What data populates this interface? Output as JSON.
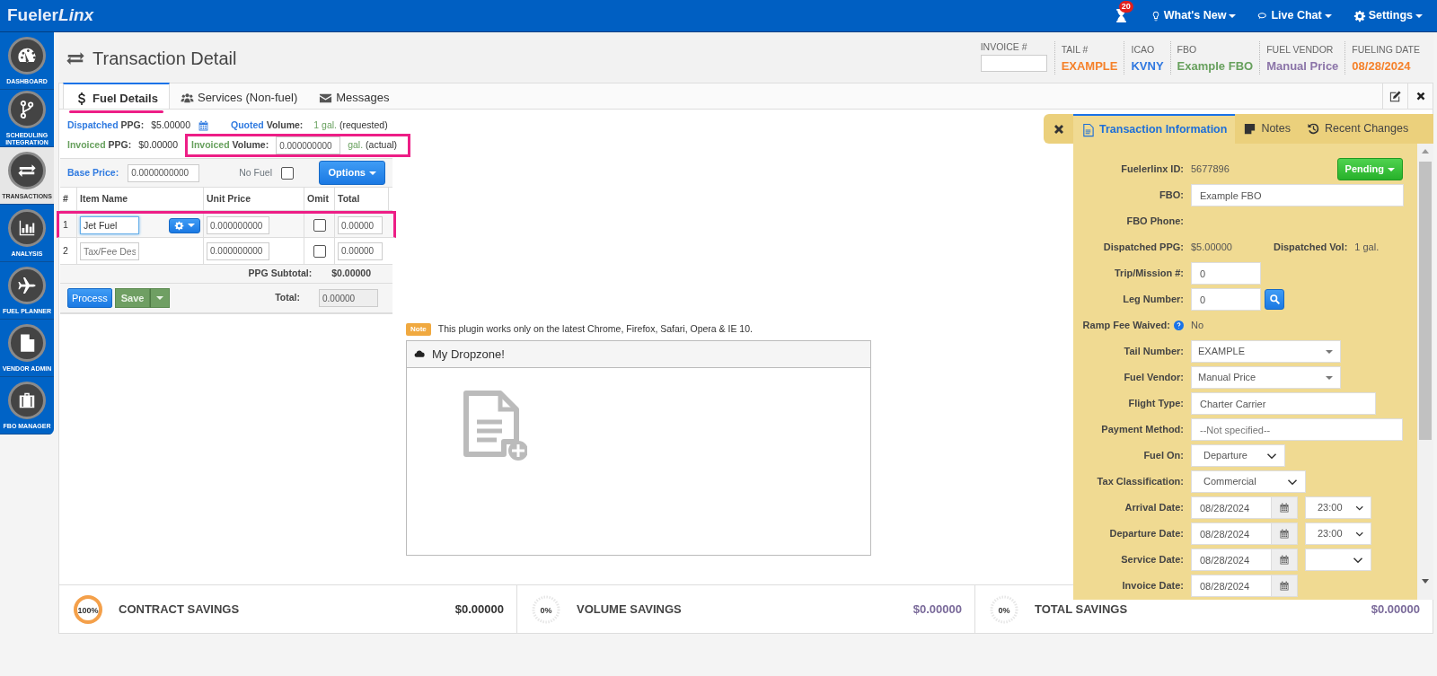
{
  "app": {
    "logo": "Fueler",
    "logo_suffix": "Linx"
  },
  "navbar": {
    "notification_count": "20",
    "menus": [
      {
        "kind": "bulb",
        "label": "What's New"
      },
      {
        "kind": "chat",
        "label": "Live Chat"
      },
      {
        "kind": "gear",
        "label": "Settings"
      }
    ]
  },
  "sidebar": [
    {
      "kind": "gauge",
      "label": "DASHBOARD",
      "selected": false
    },
    {
      "kind": "branch",
      "label": "SCHEDULING INTEGRATION",
      "selected": false
    },
    {
      "kind": "exchange",
      "label": "TRANSACTIONS",
      "selected": true
    },
    {
      "kind": "chart",
      "label": "ANALYSIS",
      "selected": false
    },
    {
      "kind": "plane",
      "label": "FUEL PLANNER",
      "selected": false
    },
    {
      "kind": "document",
      "label": "VENDOR ADMIN",
      "selected": false
    },
    {
      "kind": "suitcase",
      "label": "FBO MANAGER",
      "selected": false
    }
  ],
  "page": {
    "title": "Transaction Detail"
  },
  "summary": {
    "invoice_label": "INVOICE #",
    "fields": [
      {
        "label": "TAIL #",
        "value": "EXAMPLE",
        "color": "#f5812a"
      },
      {
        "label": "ICAO",
        "value": "KVNY",
        "color": "#2f78e0"
      },
      {
        "label": "FBO",
        "value": "Example FBO",
        "color": "#67a05d"
      },
      {
        "label": "FUEL VENDOR",
        "value": "Manual Price",
        "color": "#8b74a8"
      },
      {
        "label": "FUELING DATE",
        "value": "08/28/2024",
        "color": "#f5812a"
      }
    ]
  },
  "tabs": [
    {
      "kind": "dollar",
      "label": "Fuel Details",
      "selected": true,
      "highlighted": true
    },
    {
      "kind": "users",
      "label": "Services (Non-fuel)",
      "selected": false,
      "highlighted": false
    },
    {
      "kind": "envelope",
      "label": "Messages",
      "selected": false,
      "highlighted": false
    }
  ],
  "fuel": {
    "dispatched_ppg": {
      "prefix": "Dispatched",
      "label": "PPG:",
      "value": "$5.00000"
    },
    "quoted_volume": {
      "prefix": "Quoted",
      "label": "Volume:",
      "value": "1 gal.",
      "note": "(requested)"
    },
    "invoiced_ppg": {
      "prefix": "Invoiced",
      "label": "PPG:",
      "value": "$0.00000"
    },
    "invoiced_volume": {
      "prefix": "Invoiced",
      "label": "Volume:",
      "value": "0.000000000",
      "unit": "gal.",
      "note": "(actual)",
      "highlighted": true
    },
    "base_price": {
      "label": "Base Price:",
      "value": "0.0000000000"
    },
    "no_fuel": {
      "label": "No Fuel",
      "checked": false
    },
    "options_button": "Options",
    "columns": [
      "#",
      "Item Name",
      "Unit Price",
      "Omit",
      "Total"
    ],
    "items": [
      {
        "kind": "fuel",
        "index": "1",
        "name": "Jet Fuel",
        "unit_price": "0.000000000",
        "omit": false,
        "total": "0.00000",
        "highlighted": true
      },
      {
        "kind": "fee",
        "index": "2",
        "placeholder": "Tax/Fee Des",
        "unit_price": "0.000000000",
        "omit": false,
        "total": "0.00000",
        "highlighted": false
      }
    ],
    "subtotal_label": "PPG Subtotal:",
    "subtotal": "$0.00000",
    "process_button": "Process",
    "save_button": "Save",
    "total_label": "Total:",
    "total": "0.00000"
  },
  "upload": {
    "note_badge": "Note",
    "note_text": "This plugin works only on the latest Chrome, Firefox, Safari, Opera & IE 10.",
    "dropzone_title": "My Dropzone!"
  },
  "savings": [
    {
      "reading": "100%",
      "level": 1,
      "label": "CONTRACT SAVINGS",
      "value": "$0.00000",
      "color": "#333333"
    },
    {
      "reading": "0%",
      "level": 0,
      "label": "VOLUME SAVINGS",
      "value": "$0.00000",
      "color": "#7a6a9a"
    },
    {
      "reading": "0%",
      "level": 0,
      "label": "TOTAL SAVINGS",
      "value": "$0.00000",
      "color": "#7a6a9a"
    }
  ],
  "info_panel": {
    "tabs": [
      {
        "kind": "document",
        "label": "Transaction Information",
        "selected": true
      },
      {
        "kind": "note",
        "label": "Notes",
        "selected": false
      },
      {
        "kind": "history",
        "label": "Recent Changes",
        "selected": false
      }
    ],
    "status_button": "Pending",
    "rows": [
      {
        "kind": "text",
        "label": "Fuelerlinx ID:",
        "value": "5677896"
      },
      {
        "kind": "input",
        "label": "FBO:",
        "value": "Example FBO"
      },
      {
        "kind": "text",
        "label": "FBO Phone:"
      },
      {
        "kind": "pair",
        "label": "Dispatched PPG:",
        "value": "$5.00000",
        "label_2": "Dispatched Vol:",
        "value_2": "1 gal."
      },
      {
        "kind": "input",
        "label": "Trip/Mission #:",
        "value": "0"
      },
      {
        "kind": "search",
        "label": "Leg Number:",
        "value": "0"
      },
      {
        "kind": "help",
        "label": "Ramp Fee Waived:",
        "value": "No"
      },
      {
        "kind": "combo",
        "label": "Tail Number:",
        "value": "EXAMPLE"
      },
      {
        "kind": "combo",
        "label": "Fuel Vendor:",
        "value": "Manual Price"
      },
      {
        "kind": "input",
        "label": "Flight Type:",
        "value": "Charter Carrier"
      },
      {
        "kind": "input",
        "label": "Payment Method:",
        "placeholder": "--Not specified--"
      },
      {
        "kind": "select",
        "label": "Fuel On:",
        "value": "Departure"
      },
      {
        "kind": "select",
        "label": "Tax Classification:",
        "value": "Commercial"
      },
      {
        "kind": "datetime",
        "label": "Arrival Date:",
        "value": "08/28/2024",
        "time": "23:00"
      },
      {
        "kind": "datetime",
        "label": "Departure Date:",
        "value": "08/28/2024",
        "time": "23:00"
      },
      {
        "kind": "datetime",
        "label": "Service Date:",
        "value": "08/28/2024"
      },
      {
        "kind": "date",
        "label": "Invoice Date:",
        "value": "08/28/2024"
      }
    ]
  }
}
